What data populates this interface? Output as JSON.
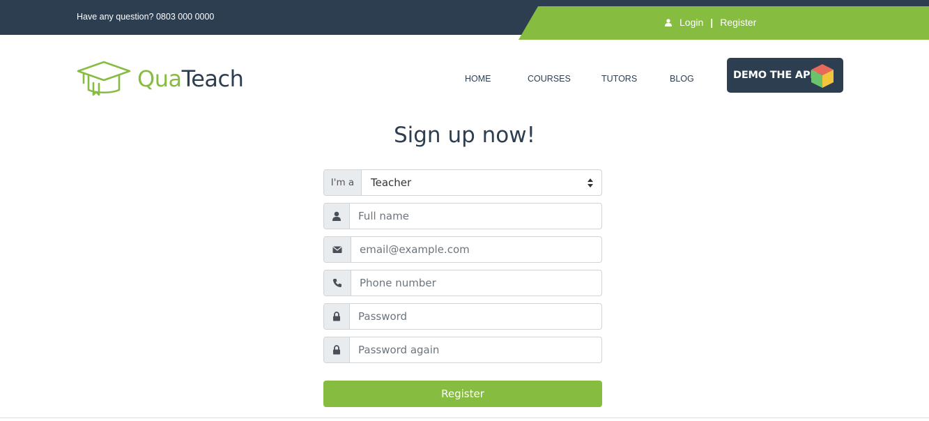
{
  "topbar": {
    "question": "Have any question? 0803 000 0000",
    "login": "Login",
    "separator": "|",
    "register": "Register"
  },
  "brand": {
    "part1": "Qua",
    "part2": "Teach",
    "logo_icon": "graduation-cap-icon"
  },
  "nav": {
    "items": [
      {
        "label": "HOME"
      },
      {
        "label": "COURSES"
      },
      {
        "label": "TUTORS"
      },
      {
        "label": "BLOG"
      }
    ]
  },
  "demo_button": {
    "label": "DEMO THE APP",
    "icon": "cube-icon"
  },
  "form": {
    "title": "Sign up now!",
    "role_prefix": "I'm a",
    "role_value": "Teacher",
    "fullname_placeholder": "Full name",
    "email_placeholder": "email@example.com",
    "phone_placeholder": "Phone number",
    "password_placeholder": "Password",
    "password_again_placeholder": "Password again",
    "submit_label": "Register"
  },
  "colors": {
    "navy": "#2c3e50",
    "green": "#86bc40"
  }
}
